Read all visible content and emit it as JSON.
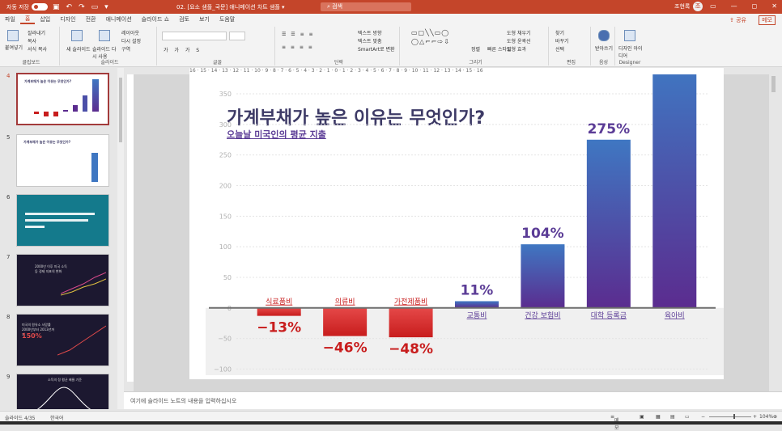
{
  "titlebar": {
    "autosave_label": "자동 저장",
    "toggle_state": "끔",
    "doc_title": "02. [요소 샘플_국문] 애니메이션 차트 샘플 ▾",
    "search_placeholder": "검색",
    "user_name": "조현록",
    "avatar_initial": "조"
  },
  "tabs": [
    "파일",
    "홈",
    "삽입",
    "디자인",
    "전환",
    "애니메이션",
    "슬라이드 쇼",
    "검토",
    "보기",
    "도움말"
  ],
  "active_tab": "홈",
  "share_label": "공유",
  "memo_label": "메모",
  "ribbon": {
    "clipboard": {
      "label": "클립보드",
      "paste": "붙여넣기",
      "cut": "잘라내기",
      "copy": "복사",
      "format_painter": "서식 복사"
    },
    "slides": {
      "label": "슬라이드",
      "new_slide": "새 슬라이드",
      "reuse": "슬라이드 다시 사용",
      "layout": "레이아웃",
      "reset": "다시 설정",
      "section": "구역"
    },
    "font": {
      "label": "글꼴"
    },
    "paragraph": {
      "label": "단락",
      "text_direction": "텍스트 방향",
      "text_align": "텍스트 맞춤",
      "smartart": "SmartArt로 변환"
    },
    "drawing": {
      "label": "그리기",
      "arrange": "정렬",
      "quick_styles": "빠른 스타일",
      "shape_fill": "도형 채우기",
      "shape_outline": "도형 윤곽선",
      "shape_effects": "도형 효과"
    },
    "editing": {
      "label": "편집",
      "find": "찾기",
      "replace": "바꾸기",
      "select": "선택"
    },
    "voice": {
      "label": "음성",
      "dictate": "받아쓰기"
    },
    "designer": {
      "label": "Designer",
      "design_ideas": "디자인 아이디어"
    }
  },
  "slide_numbers": [
    "4",
    "5",
    "6",
    "7",
    "8",
    "9"
  ],
  "thumb_texts": {
    "t4_title": "가계부채가 높은 이유는 무엇인가?",
    "t5_title": "가계부채가 높은 이유는 무엇인가?",
    "t7_title": "2000년 이후 미국 소득 등 경제 지표의 변화",
    "t8_title": "미국의 원유소 사망률 2000년부터 2013년까지",
    "t8_value": "150%",
    "t9_title": "소득의 정 평균 배율 기준"
  },
  "ruler_text": "16 · 15 · 14 · 13 · 12 · 11 · 10 · 9 · 8 · 7 · 6 · 5 · 4 · 3 · 2 · 1 · 0 · 1 · 2 · 3 · 4 · 5 · 6 · 7 · 8 · 9 · 10 · 11 · 12 · 13 · 14 · 15 · 16",
  "slide": {
    "title": "가계부채가 높은 이유는 무엇인가?",
    "subtitle": "오늘날 미국인의 평균 지출"
  },
  "chart_data": {
    "type": "bar",
    "title": "",
    "categories": [
      "식료품비",
      "의류비",
      "가전제품비",
      "교통비",
      "건강 보험비",
      "대학 등록금",
      "육아비"
    ],
    "values": [
      -13,
      -46,
      -48,
      11,
      104,
      275,
      400
    ],
    "value_labels": [
      "−13%",
      "−46%",
      "−48%",
      "11%",
      "104%",
      "275%",
      ""
    ],
    "yticks": [
      -100,
      -50,
      0,
      50,
      100,
      150,
      200,
      250,
      300,
      350
    ],
    "ytick_labels": [
      "−100",
      "−50",
      "0",
      "50",
      "100",
      "150",
      "200",
      "250",
      "300",
      "350"
    ],
    "ylim": [
      -110,
      395
    ],
    "grid": true,
    "colors": {
      "negative": "#c81d1d",
      "positive_start": "#5b2c8f",
      "positive_end": "#3f77c2",
      "label_neg": "#c81d1d",
      "label_pos": "#5b3c96"
    }
  },
  "notes_placeholder": "여기에 슬라이드 노트의 내용을 입력하십시오",
  "status": {
    "slide_info": "슬라이드 4/35",
    "language": "한국어",
    "notes_btn": "메모",
    "zoom": "104%"
  }
}
